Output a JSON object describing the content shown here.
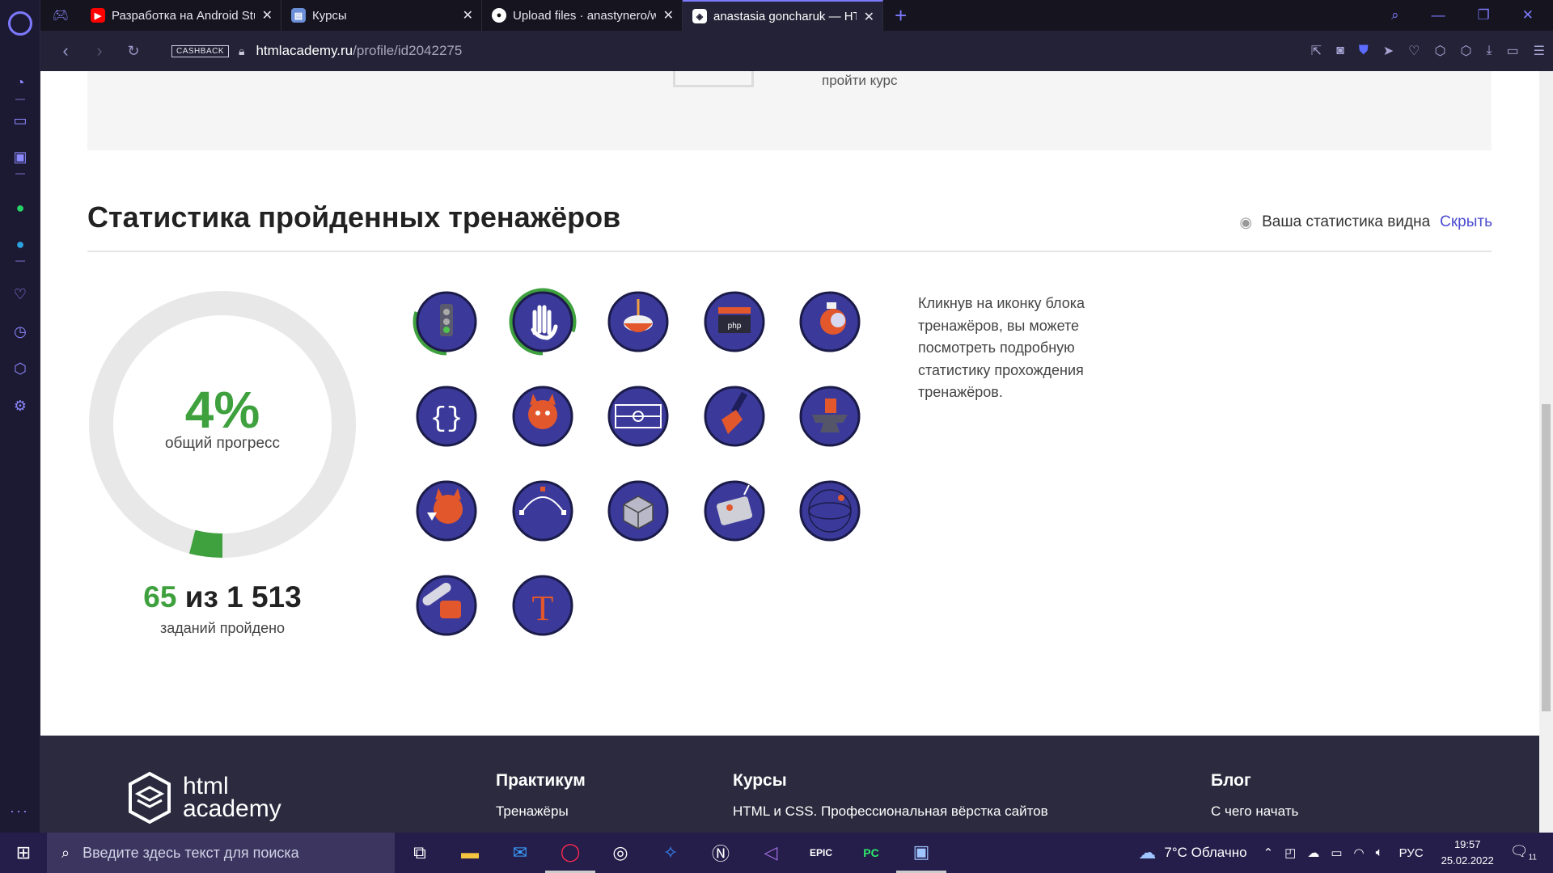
{
  "browser": {
    "tabs": [
      {
        "label": "Разработка на Android Stu",
        "icon": "youtube-icon",
        "color": "#ff0000"
      },
      {
        "label": "Курсы",
        "icon": "courses-icon",
        "color": "#6a8fd8"
      },
      {
        "label": "Upload files · anastynero/w",
        "icon": "github-icon",
        "color": "#ffffff"
      },
      {
        "label": "anastasia goncharuk — HTI",
        "icon": "htmlacademy-icon",
        "color": "#ffffff",
        "active": true
      }
    ],
    "cashback": "CASHBACK",
    "url_host": "htmlacademy.ru",
    "url_path": "/profile/id2042275"
  },
  "page": {
    "course_link": "пройти курс",
    "stats": {
      "title": "Статистика пройденных тренажёров",
      "visibility_text": "Ваша статистика видна",
      "hide_link": "Скрыть",
      "percent": "4%",
      "percent_value": 0.04,
      "progress_label": "общий прогресс",
      "done": "65",
      "of_text": "из",
      "total": "1 513",
      "tasks_label": "заданий пройдено",
      "hint": "Кликнув на иконку блока тренажёров, вы можете посмотреть подробную статистику прохождения тренажёров.",
      "accent": "#3ea13e",
      "trainers": [
        {
          "name": "traffic-light",
          "progress": 0.3
        },
        {
          "name": "hand",
          "progress": 0.8
        },
        {
          "name": "spinning-top",
          "progress": 0
        },
        {
          "name": "php-clapper",
          "progress": 0
        },
        {
          "name": "diving-helmet",
          "progress": 0
        },
        {
          "name": "braces",
          "progress": 0
        },
        {
          "name": "cat-with-glass",
          "progress": 0
        },
        {
          "name": "football-field",
          "progress": 0
        },
        {
          "name": "paint-brush",
          "progress": 0
        },
        {
          "name": "anvil",
          "progress": 0
        },
        {
          "name": "cat-cocktail",
          "progress": 0
        },
        {
          "name": "bezier-curve",
          "progress": 0
        },
        {
          "name": "rubik-cube",
          "progress": 0
        },
        {
          "name": "robot-box",
          "progress": 0
        },
        {
          "name": "sphere-grid",
          "progress": 0
        },
        {
          "name": "chainsaw",
          "progress": 0
        },
        {
          "name": "typography-t",
          "progress": 0
        }
      ]
    }
  },
  "footer": {
    "logo_line1": "html",
    "logo_line2": "academy",
    "col1_head": "Практикум",
    "col1_link": "Тренажёры",
    "col2_head": "Курсы",
    "col2_link": "HTML и CSS. Профессиональная вёрстка сайтов",
    "col3_head": "Блог",
    "col3_link": "С чего начать"
  },
  "taskbar": {
    "search_placeholder": "Введите здесь текст для поиска",
    "weather": "7°C  Облачно",
    "lang": "РУС",
    "time": "19:57",
    "date": "25.02.2022",
    "notif_count": "11"
  }
}
